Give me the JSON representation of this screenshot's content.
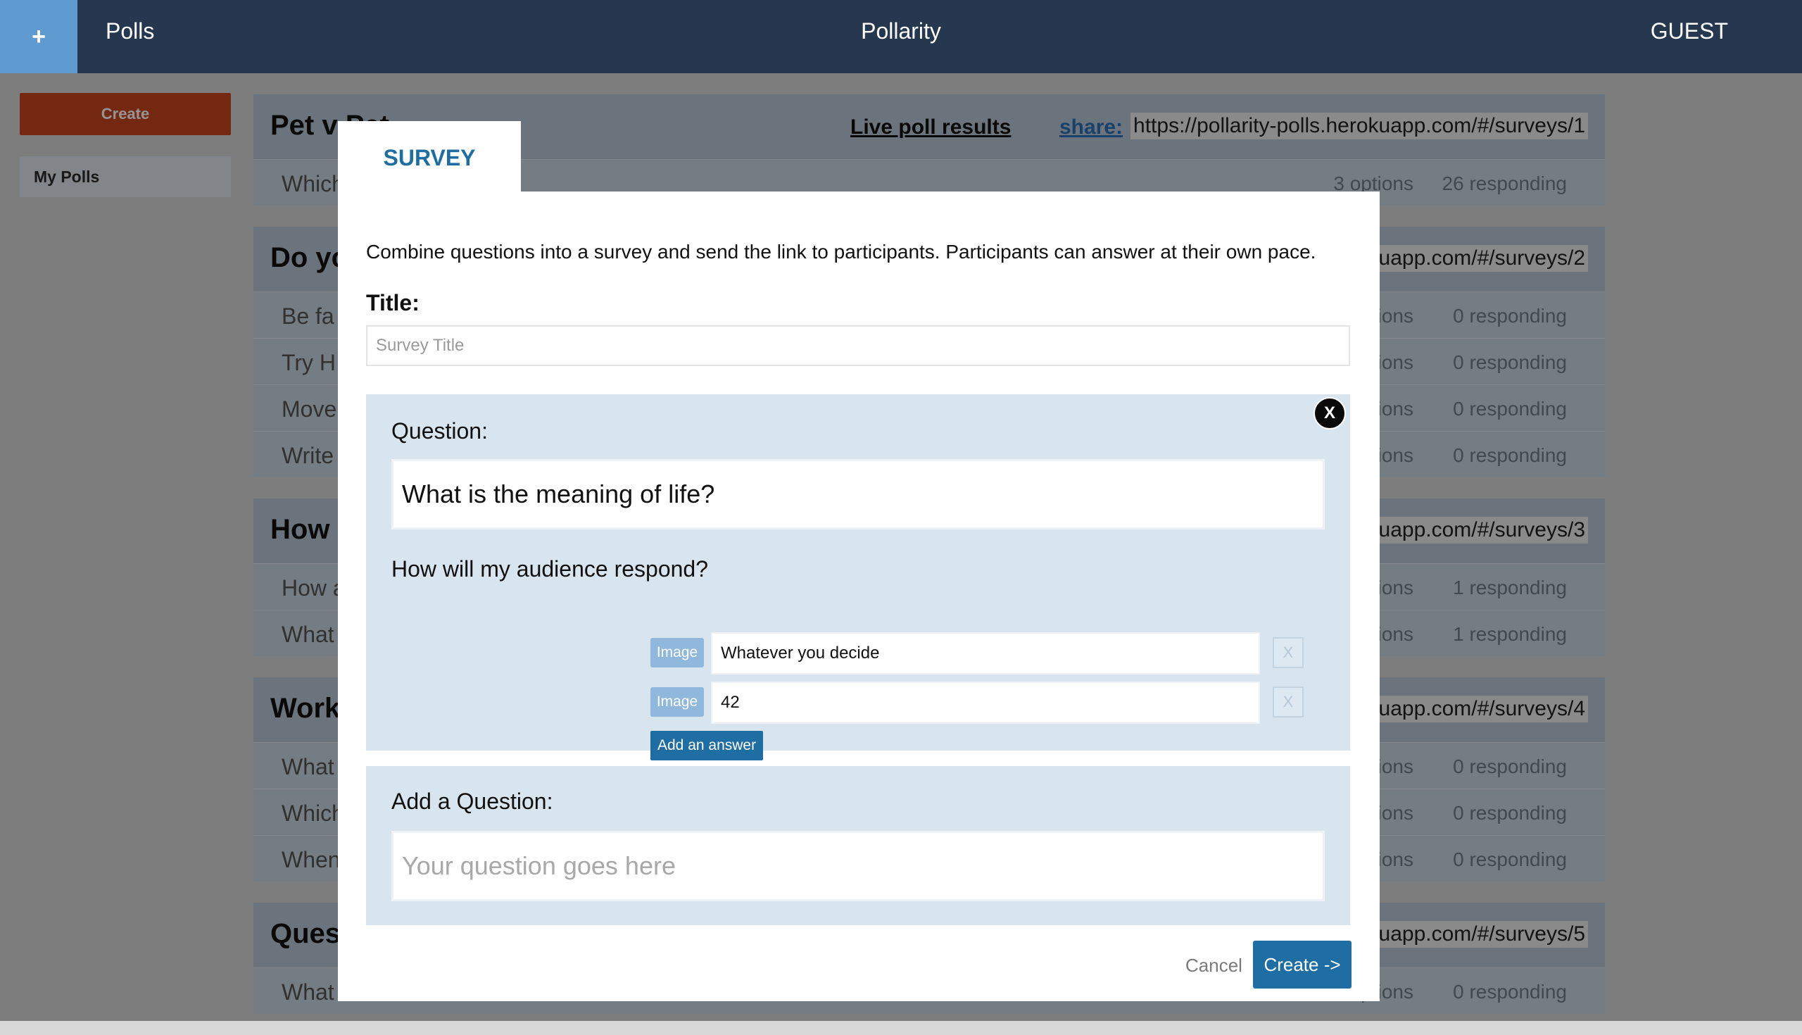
{
  "topbar": {
    "plus_label": "+",
    "nav_label": "Polls",
    "app_title": "Pollarity",
    "user_label": "GUEST"
  },
  "sidebar": {
    "create_label": "Create",
    "my_polls_label": "My Polls"
  },
  "polls": {
    "live_label": "Live poll results",
    "share_label": "share:",
    "groups": [
      {
        "title": "Pet v Pet",
        "url": "https://pollarity-polls.herokuapp.com/#/surveys/1",
        "rows": [
          {
            "q": "Which",
            "opts": "3 options",
            "resp": "26 responding"
          }
        ]
      },
      {
        "title": "Do yo",
        "url": "uapp.com/#/surveys/2",
        "rows": [
          {
            "q": "Be fa",
            "opts": "ptions",
            "resp": "0 responding"
          },
          {
            "q": "Try H",
            "opts": "ptions",
            "resp": "0 responding"
          },
          {
            "q": "Move",
            "opts": "ptions",
            "resp": "0 responding"
          },
          {
            "q": "Write",
            "opts": "ptions",
            "resp": "0 responding"
          }
        ]
      },
      {
        "title": "How",
        "url": "uapp.com/#/surveys/3",
        "rows": [
          {
            "q": "How a",
            "opts": "ptions",
            "resp": "1 responding"
          },
          {
            "q": "What",
            "opts": "ptions",
            "resp": "1 responding"
          }
        ]
      },
      {
        "title": "Work",
        "url": "uapp.com/#/surveys/4",
        "rows": [
          {
            "q": "What",
            "opts": "ptions",
            "resp": "0 responding"
          },
          {
            "q": "Which",
            "opts": "ptions",
            "resp": "0 responding"
          },
          {
            "q": "When",
            "opts": "ptions",
            "resp": "0 responding"
          }
        ]
      },
      {
        "title": "Ques",
        "url": "uapp.com/#/surveys/5",
        "rows": [
          {
            "q": "What",
            "opts": "ptions",
            "resp": "0 responding"
          }
        ]
      }
    ]
  },
  "modal": {
    "tab_label": "SURVEY",
    "intro": "Combine questions into a survey and send the link to participants. Participants can answer at their own pace.",
    "title_label": "Title:",
    "title_placeholder": "Survey Title",
    "question_label": "Question:",
    "question_value": "What is the meaning of life?",
    "close_label": "X",
    "respond_label": "How will my audience respond?",
    "answers": [
      {
        "image_label": "Image",
        "value": "Whatever you decide",
        "remove_label": "X"
      },
      {
        "image_label": "Image",
        "value": "42",
        "remove_label": "X"
      }
    ],
    "add_answer_label": "Add an answer",
    "add_question_label": "Add a Question:",
    "add_question_placeholder": "Your question goes here",
    "cancel_label": "Cancel",
    "create_label": "Create ->"
  },
  "colors": {
    "topbar_bg": "#26384f",
    "plus_bg": "#5f9bd0",
    "create_side_bg": "#c9461f",
    "accent": "#1f6ea3",
    "panel_bg": "#d8e4ee"
  }
}
